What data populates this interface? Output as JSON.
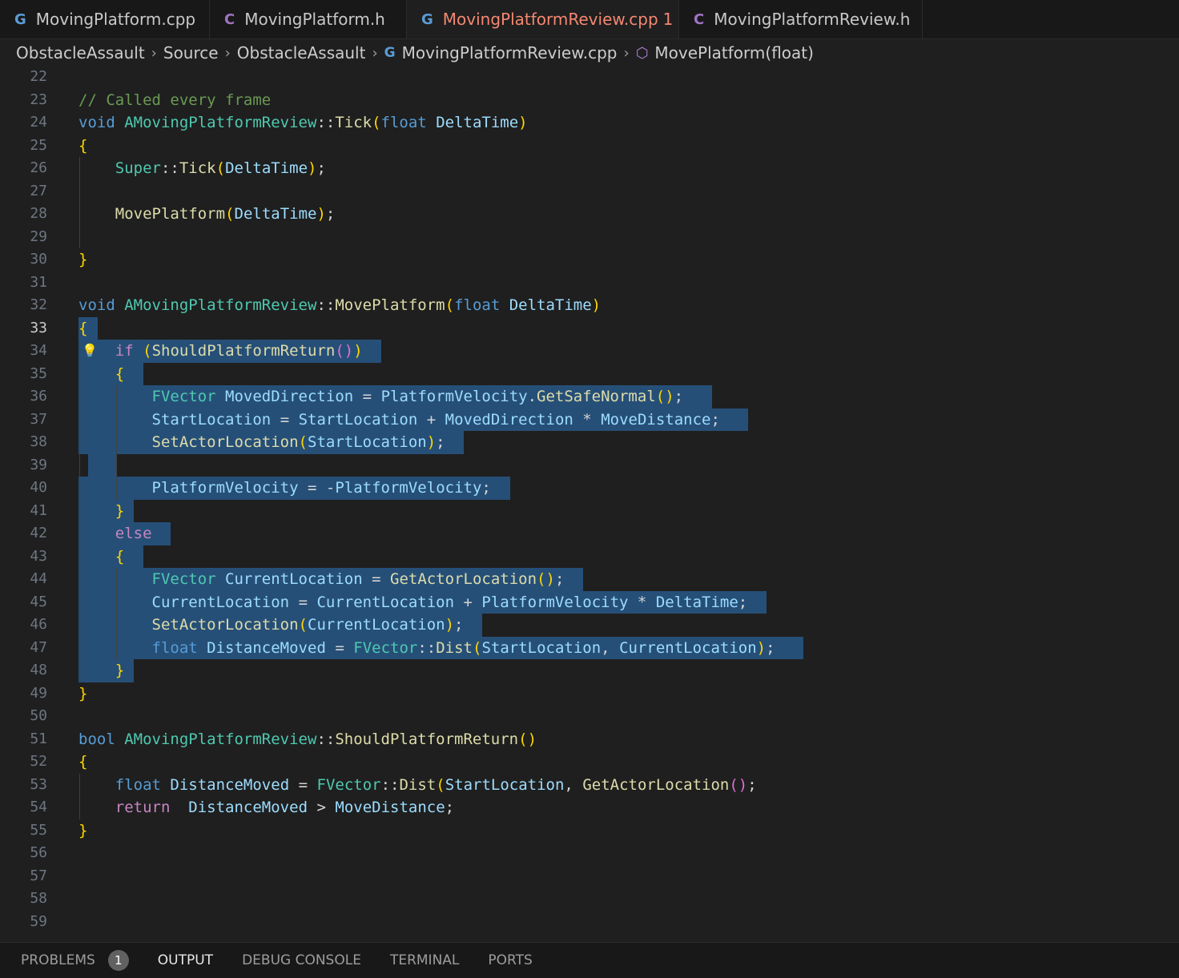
{
  "tabs": [
    {
      "label": "MovingPlatform.cpp",
      "icon": "cpp-file-icon",
      "active": false
    },
    {
      "label": "MovingPlatform.h",
      "icon": "c-header-icon",
      "active": false
    },
    {
      "label": "MovingPlatformReview.cpp",
      "icon": "cpp-file-icon",
      "active": true,
      "problems": "1",
      "modified": true
    },
    {
      "label": "MovingPlatformReview.h",
      "icon": "c-header-icon",
      "active": false
    }
  ],
  "breadcrumb": [
    "ObstacleAssault",
    "Source",
    "ObstacleAssault",
    "MovingPlatformReview.cpp",
    "MovePlatform(float)"
  ],
  "panel": {
    "problems": "PROBLEMS",
    "problems_count": "1",
    "output": "OUTPUT",
    "debug_console": "DEBUG CONSOLE",
    "terminal": "TERMINAL",
    "ports": "PORTS"
  },
  "line_numbers": [
    "22",
    "23",
    "24",
    "25",
    "26",
    "27",
    "28",
    "29",
    "30",
    "31",
    "32",
    "33",
    "34",
    "35",
    "36",
    "37",
    "38",
    "39",
    "40",
    "41",
    "42",
    "43",
    "44",
    "45",
    "46",
    "47",
    "48",
    "49",
    "50",
    "51",
    "52",
    "53",
    "54",
    "55",
    "56",
    "57",
    "58",
    "59"
  ],
  "current_line": "33",
  "code": [
    "",
    "// Called every frame",
    "void AMovingPlatformReview::Tick(float DeltaTime)",
    "{",
    "    Super::Tick(DeltaTime);",
    "",
    "    MovePlatform(DeltaTime);",
    "",
    "}",
    "",
    "void AMovingPlatformReview::MovePlatform(float DeltaTime)",
    "{",
    "    if (ShouldPlatformReturn())",
    "    {",
    "        FVector MovedDirection = PlatformVelocity.GetSafeNormal();",
    "        StartLocation = StartLocation + MovedDirection * MoveDistance;",
    "        SetActorLocation(StartLocation);",
    "",
    "        PlatformVelocity = -PlatformVelocity;",
    "    }",
    "    else",
    "    {",
    "        FVector CurrentLocation = GetActorLocation();",
    "        CurrentLocation = CurrentLocation + PlatformVelocity * DeltaTime;",
    "        SetActorLocation(CurrentLocation);",
    "        float DistanceMoved = FVector::Dist(StartLocation, CurrentLocation);",
    "    }",
    "}",
    "",
    "bool AMovingPlatformReview::ShouldPlatformReturn()",
    "{",
    "    float DistanceMoved = FVector::Dist(StartLocation, GetActorLocation();",
    "    return  DistanceMoved > MoveDistance;",
    "}",
    "",
    "",
    "",
    ""
  ],
  "colors": {
    "background": "#1f1f1f",
    "selection": "#264f78",
    "keyword": "#569cd6",
    "function": "#dcdcaa",
    "type": "#4ec9b0",
    "variable": "#9cdcfe",
    "comment": "#6a9955",
    "active_tab": "#f48771"
  }
}
